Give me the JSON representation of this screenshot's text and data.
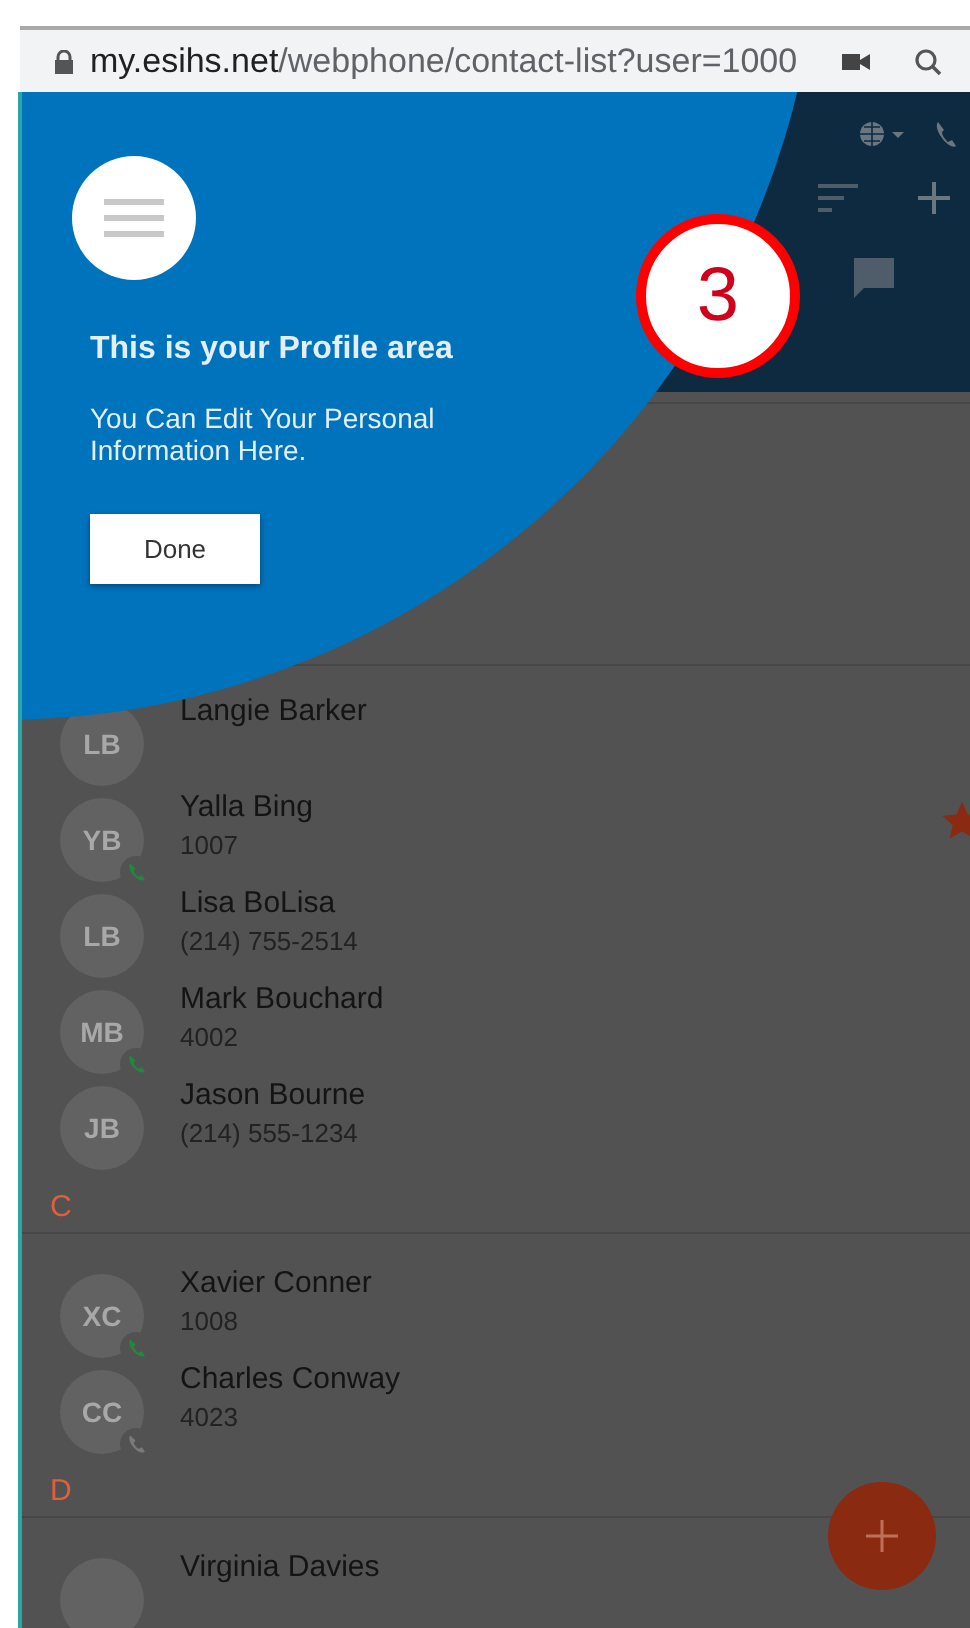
{
  "browser": {
    "url_host": "my.esihs.net",
    "url_path": "/webphone/contact-list?user=1000"
  },
  "tour": {
    "title": "This is your Profile area",
    "body": "You Can Edit Your Personal Information Here.",
    "button": "Done"
  },
  "annotation": {
    "number": "3"
  },
  "sections": [
    {
      "contacts": [
        {
          "initials": "LB",
          "name": "Langie Barker",
          "favorite": false
        },
        {
          "initials": "YB",
          "name": "Yalla Bing",
          "number": "1007",
          "color": "#1f8a3a",
          "favorite": true
        },
        {
          "initials": "LB",
          "name": "Lisa BoLisa",
          "number": "(214) 755-2514",
          "favorite": false
        },
        {
          "initials": "MB",
          "name": "Mark Bouchard",
          "number": "4002",
          "color": "#1f8a3a",
          "favorite": false
        },
        {
          "initials": "JB",
          "name": "Jason Bourne",
          "number": "(214) 555-1234",
          "favorite": false
        }
      ]
    },
    {
      "letter": "C",
      "contacts": [
        {
          "initials": "XC",
          "name": "Xavier Conner",
          "number": "1008",
          "color": "#1f8a3a",
          "favorite": false
        },
        {
          "initials": "CC",
          "name": "Charles Conway",
          "number": "4023",
          "color": "#7a7a7a",
          "favorite": false
        }
      ]
    },
    {
      "letter": "D",
      "contacts": [
        {
          "name": "Virginia Davies",
          "favorite": false
        }
      ]
    }
  ]
}
